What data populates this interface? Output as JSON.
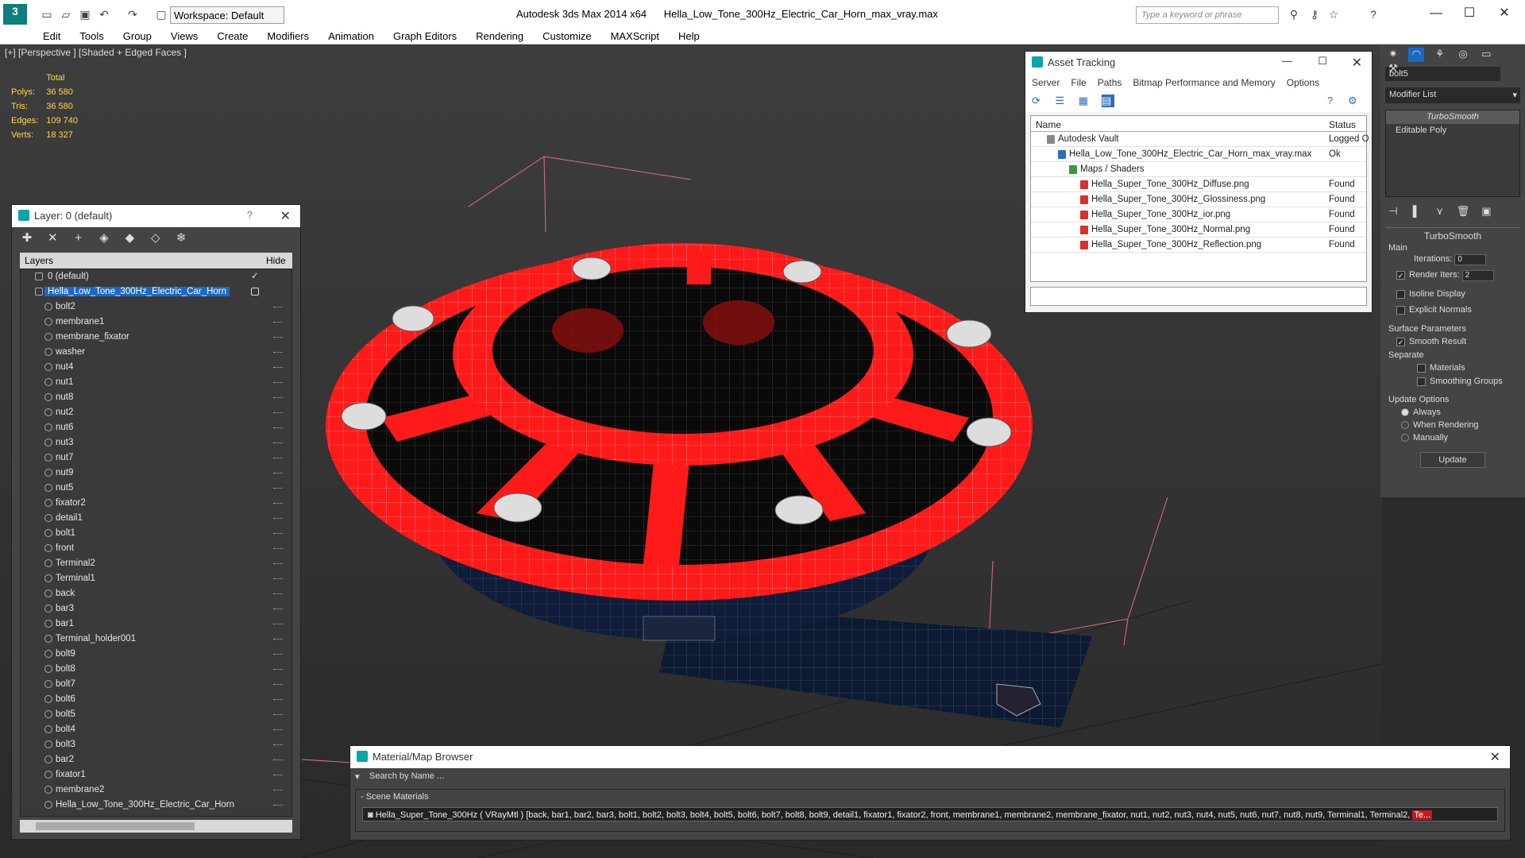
{
  "titlebar": {
    "app_title": "Autodesk 3ds Max  2014 x64",
    "file_title": "Hella_Low_Tone_300Hz_Electric_Car_Horn_max_vray.max",
    "workspace": "Workspace: Default",
    "search_placeholder": "Type a keyword or phrase"
  },
  "menu": [
    "Edit",
    "Tools",
    "Group",
    "Views",
    "Create",
    "Modifiers",
    "Animation",
    "Graph Editors",
    "Rendering",
    "Customize",
    "MAXScript",
    "Help"
  ],
  "viewport": {
    "label": "[+] [Perspective ] [Shaded + Edged Faces ]",
    "stats": {
      "header": "Total",
      "rows": [
        {
          "k": "Polys:",
          "v": "36 580"
        },
        {
          "k": "Tris:",
          "v": "36 580"
        },
        {
          "k": "Edges:",
          "v": "109 740"
        },
        {
          "k": "Verts:",
          "v": "18 327"
        }
      ]
    }
  },
  "layer_panel": {
    "title": "Layer: 0 (default)",
    "help": "?",
    "col_layers": "Layers",
    "col_hide": "Hide",
    "default_layer": "0 (default)",
    "selected_layer": "Hella_Low_Tone_300Hz_Electric_Car_Horn",
    "objects": [
      "bolt2",
      "membrane1",
      "membrane_fixator",
      "washer",
      "nut4",
      "nut1",
      "nut8",
      "nut2",
      "nut6",
      "nut3",
      "nut7",
      "nut9",
      "nut5",
      "fixator2",
      "detail1",
      "bolt1",
      "front",
      "Terminal2",
      "Terminal1",
      "back",
      "bar3",
      "bar1",
      "Terminal_holder001",
      "bolt9",
      "bolt8",
      "bolt7",
      "bolt6",
      "bolt5",
      "bolt4",
      "bolt3",
      "bar2",
      "fixator1",
      "membrane2",
      "Hella_Low_Tone_300Hz_Electric_Car_Horn"
    ]
  },
  "asset_tracking": {
    "title": "Asset Tracking",
    "menu": [
      "Server",
      "File",
      "Paths",
      "Bitmap Performance and Memory",
      "Options"
    ],
    "col_name": "Name",
    "col_status": "Status",
    "rows": [
      {
        "name": "Autodesk Vault",
        "status": "Logged O",
        "indent": 0,
        "icon": "vault-icon",
        "icon_color": "#888888"
      },
      {
        "name": "Hella_Low_Tone_300Hz_Electric_Car_Horn_max_vray.max",
        "status": "Ok",
        "indent": 1,
        "icon": "max-file-icon",
        "icon_color": "#2a6fbf"
      },
      {
        "name": "Maps / Shaders",
        "status": "",
        "indent": 2,
        "icon": "maps-icon",
        "icon_color": "#3a9a3a"
      },
      {
        "name": "Hella_Super_Tone_300Hz_Diffuse.png",
        "status": "Found",
        "indent": 3,
        "icon": "png-icon",
        "icon_color": "#d9302a"
      },
      {
        "name": "Hella_Super_Tone_300Hz_Glossiness.png",
        "status": "Found",
        "indent": 3,
        "icon": "png-icon",
        "icon_color": "#d9302a"
      },
      {
        "name": "Hella_Super_Tone_300Hz_ior.png",
        "status": "Found",
        "indent": 3,
        "icon": "png-icon",
        "icon_color": "#d9302a"
      },
      {
        "name": "Hella_Super_Tone_300Hz_Normal.png",
        "status": "Found",
        "indent": 3,
        "icon": "png-icon",
        "icon_color": "#d9302a"
      },
      {
        "name": "Hella_Super_Tone_300Hz_Reflection.png",
        "status": "Found",
        "indent": 3,
        "icon": "png-icon",
        "icon_color": "#d9302a"
      }
    ]
  },
  "command_panel": {
    "object_name": "bolt5",
    "modifier_list": "Modifier List",
    "stack": [
      "TurboSmooth",
      "Editable Poly"
    ],
    "rollout_title": "TurboSmooth",
    "main_label": "Main",
    "iterations_label": "Iterations:",
    "iterations_value": "0",
    "render_iters_label": "Render Iters:",
    "render_iters_value": "2",
    "isoline": "Isoline Display",
    "explicit": "Explicit Normals",
    "surface_params": "Surface Parameters",
    "smooth_result": "Smooth Result",
    "separate": "Separate",
    "materials": "Materials",
    "smoothing_groups": "Smoothing Groups",
    "update_options": "Update Options",
    "always": "Always",
    "when_rendering": "When Rendering",
    "manually": "Manually",
    "update_btn": "Update"
  },
  "material_browser": {
    "title": "Material/Map Browser",
    "search_placeholder": "Search by Name ...",
    "section": "- Scene Materials",
    "material_line": "Hella_Super_Tone_300Hz  ( VRayMtl )  [back, bar1, bar2, bar3, bolt1, bolt2, bolt3, bolt4, bolt5, bolt6, bolt7, bolt8, bolt9, detail1, fixator1, fixator2, front, membrane1, membrane2, membrane_fixator, nut1, nut2, nut3, nut4, nut5, nut6, nut7, nut8, nut9, Terminal1, Terminal2, ",
    "material_tail": "Te..."
  },
  "colors": {
    "accent": "#1a69c7",
    "horn_red": "#ff1a1a",
    "stats_yellow": "#ffd84a"
  }
}
